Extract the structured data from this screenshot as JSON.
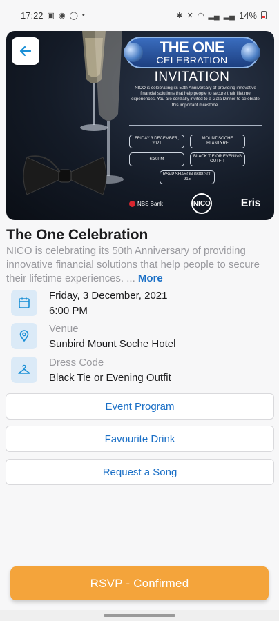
{
  "status_bar": {
    "time": "17:22",
    "battery": "14%"
  },
  "hero": {
    "banner_line1": "THE ONE",
    "banner_line2": "CELEBRATION",
    "invitation_title": "INVITATION",
    "invitation_text": "NICO is celebrating its 50th Anniversary of providing innovative financial solutions that help people to secure their lifetime experiences. You are cordially invited to a Gala Dinner to celebrate this important milestone.",
    "pill_date": "FRIDAY 3 DECEMBER, 2021",
    "pill_place": "MOUNT SOCHE BLANTYRE",
    "pill_time": "6:30PM",
    "pill_dress": "BLACK TIE OR EVENING OUTFIT",
    "pill_rsvp": "RSVP SHARON 0888 300 915",
    "logo_mbs": "NBS Bank",
    "logo_nico": "NICO",
    "logo_eris": "Eris"
  },
  "event": {
    "title": "The One Celebration",
    "description": "NICO is celebrating its 50th Anniversary of providing innovative financial solutions that help people to secure their lifetime experiences. ...",
    "more_label": "More",
    "date": "Friday, 3 December, 2021",
    "time": "6:00 PM",
    "venue_label": "Venue",
    "venue": "Sunbird Mount Soche Hotel",
    "dress_label": "Dress Code",
    "dress": "Black Tie or Evening Outfit"
  },
  "actions": {
    "program": "Event Program",
    "drink": "Favourite Drink",
    "song": "Request a Song"
  },
  "rsvp_label": "RSVP - Confirmed",
  "colors": {
    "accent_blue": "#1a6fc6",
    "rsvp_orange": "#f4a43b",
    "icon_bg": "#dbeaf7"
  },
  "icons": {
    "back": "arrow-left-icon",
    "calendar": "calendar-icon",
    "venue": "location-pin-icon",
    "dress": "hanger-icon"
  }
}
